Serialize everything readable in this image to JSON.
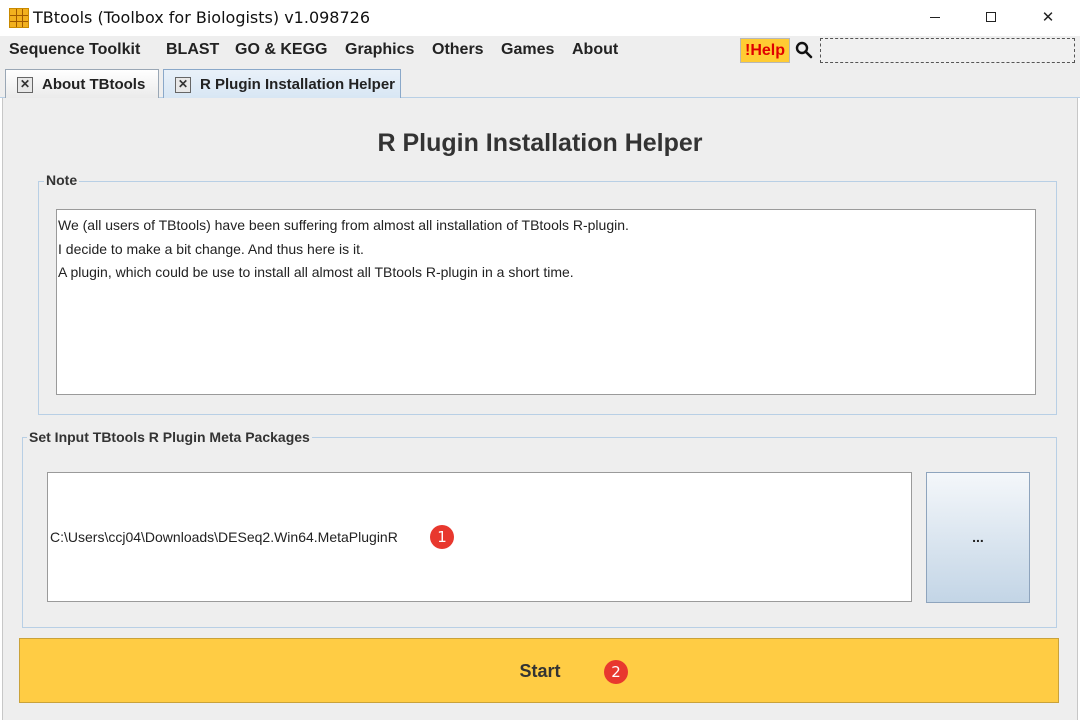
{
  "window": {
    "title": "TBtools (Toolbox for Biologists) v1.098726",
    "minimize_glyph": "",
    "close_glyph": "✕"
  },
  "menu": {
    "items": [
      "Sequence Toolkit",
      "BLAST",
      "GO & KEGG",
      "Graphics",
      "Others",
      "Games",
      "About"
    ],
    "help_label": "!Help",
    "search_placeholder": ""
  },
  "tabs": [
    {
      "label": "About TBtools",
      "active": false
    },
    {
      "label": "R Plugin Installation Helper",
      "active": true
    }
  ],
  "tab_close_glyph": "✕",
  "page": {
    "title": "R Plugin Installation Helper"
  },
  "note": {
    "label": "Note",
    "lines": [
      "We (all users of TBtools) have been suffering from almost all installation of TBtools R-plugin.",
      "I decide to make a bit change. And thus here is it.",
      "A plugin, which could be use to install all almost all TBtools R-plugin in a short time."
    ]
  },
  "input_group": {
    "label": "Set Input TBtools R Plugin Meta Packages",
    "path_value": "C:\\Users\\ccj04\\Downloads\\DESeq2.Win64.MetaPluginR",
    "browse_label": "..."
  },
  "start": {
    "label": "Start"
  },
  "annotations": {
    "badge_1": "1",
    "badge_2": "2"
  },
  "colors": {
    "accent_yellow": "#ffcc44",
    "help_text_red": "#e00000",
    "badge_red": "#e8382e",
    "tab_active_blue": "#d7e6f4"
  },
  "icons": [
    "app-grid-icon",
    "search-icon",
    "tab-close-icon",
    "minimize-icon",
    "maximize-icon",
    "close-icon"
  ]
}
